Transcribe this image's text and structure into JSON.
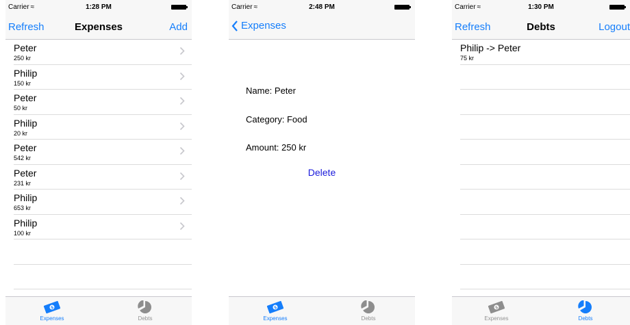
{
  "status": {
    "carrier": "Carrier",
    "wifi_icon": "wifi-icon",
    "times": [
      "1:28 PM",
      "2:48 PM",
      "1:30 PM"
    ]
  },
  "colors": {
    "accent": "#157efb",
    "delete": "#1a1adb",
    "inactive_tab": "#929292",
    "bar_background": "#f7f7f7"
  },
  "expenses_screen": {
    "nav_left": "Refresh",
    "title": "Expenses",
    "nav_right": "Add",
    "items": [
      {
        "name": "Peter",
        "amount": "250 kr"
      },
      {
        "name": "Philip",
        "amount": "150 kr"
      },
      {
        "name": "Peter",
        "amount": "50 kr"
      },
      {
        "name": "Philip",
        "amount": "20 kr"
      },
      {
        "name": "Peter",
        "amount": "542 kr"
      },
      {
        "name": "Peter",
        "amount": "231 kr"
      },
      {
        "name": "Philip",
        "amount": "653 kr"
      },
      {
        "name": "Philip",
        "amount": "100 kr"
      }
    ]
  },
  "detail_screen": {
    "back_label": "Expenses",
    "name": "Name: Peter",
    "category": "Category: Food",
    "amount": "Amount: 250 kr",
    "delete_label": "Delete"
  },
  "debts_screen": {
    "nav_left": "Refresh",
    "title": "Debts",
    "nav_right": "Logout",
    "items": [
      {
        "name": "Philip -> Peter",
        "amount": "75 kr"
      }
    ]
  },
  "tabs": {
    "expenses_label": "Expenses",
    "debts_label": "Debts",
    "expenses_icon": "money-icon",
    "debts_icon": "pie-chart-icon"
  }
}
